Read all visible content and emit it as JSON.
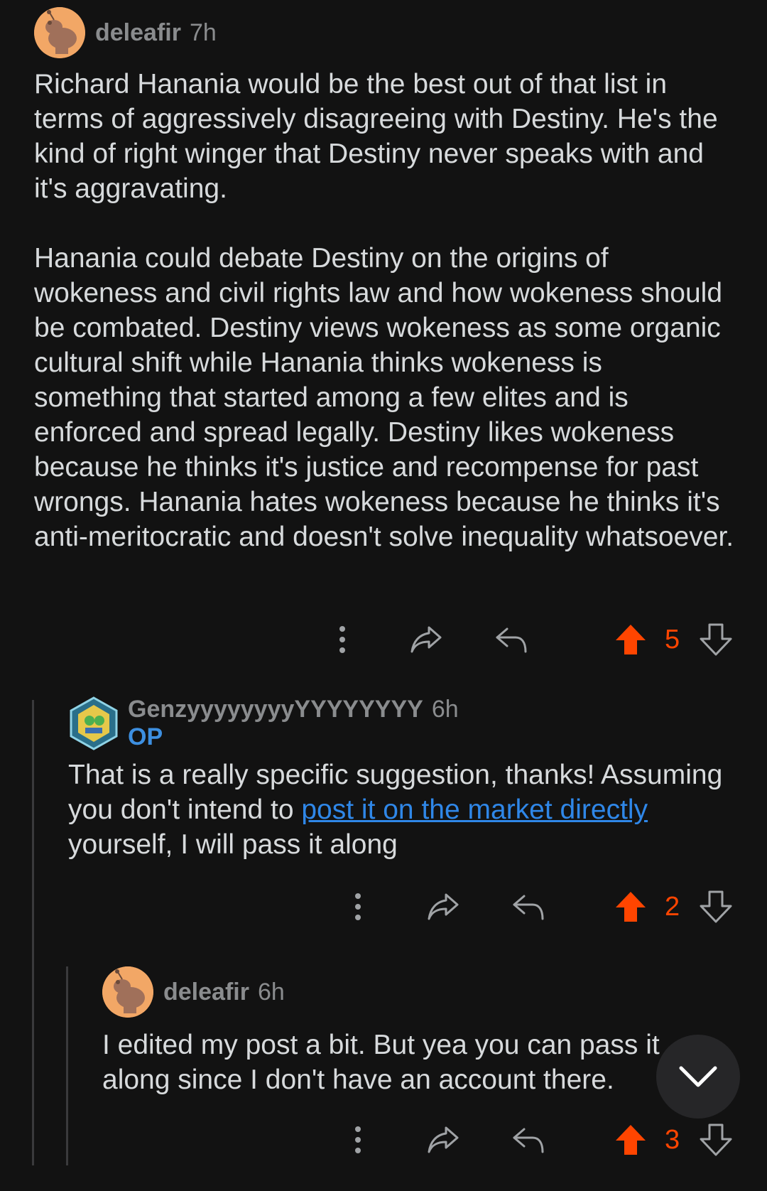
{
  "colors": {
    "background": "#121212",
    "accent_upvote": "#ff4500",
    "link": "#2f87e8",
    "op_badge": "#3d8fe0"
  },
  "comments": [
    {
      "username": "deleafir",
      "time": "7h",
      "paragraphs": [
        "Richard Hanania would be the best out of that list in terms of aggressively disagreeing with Destiny. He's the kind of right winger that Destiny never speaks with and it's aggravating.",
        "Hanania could debate Destiny on the origins of wokeness and civil rights law and how wokeness should be combated. Destiny views wokeness as some organic cultural shift while Hanania thinks wokeness is something that started among a few elites and is enforced and spread legally. Destiny likes wokeness because he thinks it's justice and recompense for past wrongs. Hanania hates wokeness because he thinks it's anti-meritocratic and doesn't solve inequality whatsoever."
      ],
      "score": "5",
      "avatar_icon": "snoo-avatar-icon"
    },
    {
      "username": "GenzyyyyyyyyYYYYYYYY",
      "time": "6h",
      "badge": "OP",
      "text_before": "That is a really specific suggestion, thanks! Assuming you don't intend to ",
      "link_text": "post it on the market directly",
      "text_after": " yourself, I will pass it along",
      "score": "2",
      "avatar_icon": "hexagon-avatar-icon"
    },
    {
      "username": "deleafir",
      "time": "6h",
      "text": "I edited my post a bit. But yea you can pass it along since I don't have an account there.",
      "score": "3",
      "avatar_icon": "snoo-avatar-icon"
    }
  ],
  "icons": {
    "more": "more-vertical-icon",
    "share": "share-icon",
    "reply": "reply-icon",
    "upvote": "upvote-icon",
    "downvote": "downvote-icon",
    "scroll": "chevron-down-icon"
  }
}
